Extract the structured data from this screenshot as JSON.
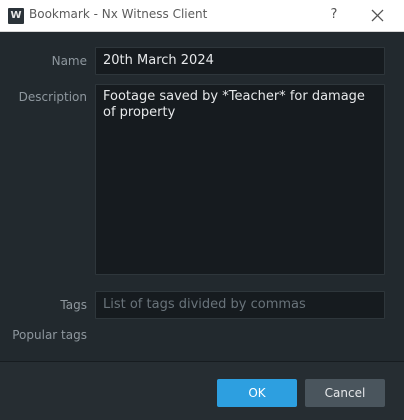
{
  "window": {
    "title": "Bookmark - Nx Witness Client",
    "app_icon_letter": "W",
    "help_label": "?",
    "close_icon": "close-icon"
  },
  "form": {
    "name_label": "Name",
    "name_value": "20th March 2024",
    "description_label": "Description",
    "description_value": "Footage saved by *Teacher* for damage of property",
    "tags_label": "Tags",
    "tags_placeholder": "List of tags divided by commas",
    "popular_tags_label": "Popular tags"
  },
  "buttons": {
    "ok_label": "OK",
    "cancel_label": "Cancel"
  },
  "colors": {
    "background": "#22292e",
    "field_background": "#161b1f",
    "accent": "#2d9fe0",
    "secondary_button": "#4a555d"
  }
}
